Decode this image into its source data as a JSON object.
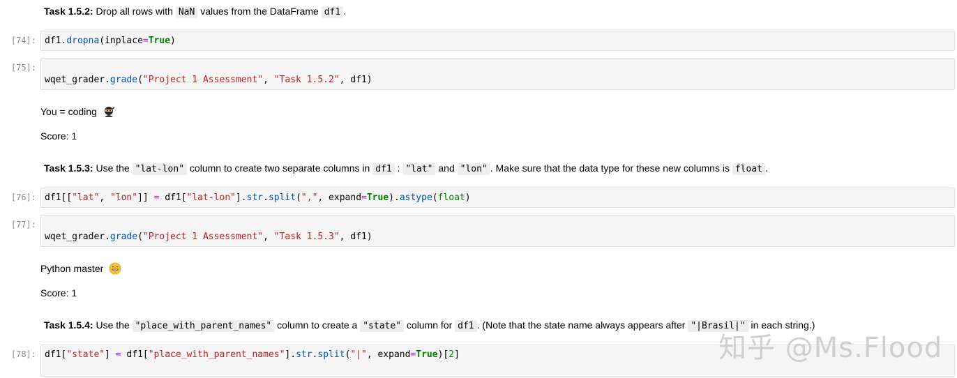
{
  "tasks": {
    "t152": {
      "label": "Task 1.5.2:",
      "text1": " Drop all rows with ",
      "code1": "NaN",
      "text2": " values from the DataFrame ",
      "code2": "df1",
      "text3": "."
    },
    "t153": {
      "label": "Task 1.5.3:",
      "text1": " Use the ",
      "code1": "\"lat-lon\"",
      "text2": " column to create two separate columns in ",
      "code2": "df1",
      "text3": " : ",
      "code3": "\"lat\"",
      "text4": " and ",
      "code4": "\"lon\"",
      "text5": ". Make sure that the data type for these new columns is ",
      "code5": "float",
      "text6": "."
    },
    "t154": {
      "label": "Task 1.5.4:",
      "text1": " Use the ",
      "code1": "\"place_with_parent_names\"",
      "text2": " column to create a ",
      "code2": "\"state\"",
      "text3": " column for ",
      "code3": "df1",
      "text4": ". (Note that the state name always appears after ",
      "code4": "\"|Brasil|\"",
      "text5": " in each string.)"
    }
  },
  "cells": {
    "c74": {
      "prompt": "[74]:",
      "tokens": {
        "a": "df1.",
        "b": "dropna",
        "c": "(inplace",
        "d": "=",
        "e": "True",
        "f": ")"
      }
    },
    "c75": {
      "prompt": "[75]:",
      "tokens": {
        "a": "wqet_grader.",
        "b": "grade",
        "c": "(",
        "d": "\"Project 1 Assessment\"",
        "e": ", ",
        "f": "\"Task 1.5.2\"",
        "g": ", df1)"
      }
    },
    "c76": {
      "prompt": "[76]:",
      "tokens": {
        "a": "df1[[",
        "b": "\"lat\"",
        "c": ", ",
        "d": "\"lon\"",
        "e": "]] ",
        "f": "=",
        "g": " df1[",
        "h": "\"lat-lon\"",
        "i": "].",
        "j": "str",
        "k": ".",
        "l": "split",
        "m": "(",
        "n": "\",\"",
        "o": ", expand",
        "p": "=",
        "q": "True",
        "r": ").",
        "s": "astype",
        "t": "(",
        "u": "float",
        "v": ")"
      }
    },
    "c77": {
      "prompt": "[77]:",
      "tokens": {
        "a": "wqet_grader.",
        "b": "grade",
        "c": "(",
        "d": "\"Project 1 Assessment\"",
        "e": ", ",
        "f": "\"Task 1.5.3\"",
        "g": ", df1)"
      }
    },
    "c78": {
      "prompt": "[78]:",
      "tokens": {
        "a": "df1[",
        "b": "\"state\"",
        "c": "] ",
        "d": "=",
        "e": " df1[",
        "f": "\"place_with_parent_names\"",
        "g": "].",
        "h": "str",
        "i": ".",
        "j": "split",
        "k": "(",
        "l": "\"|\"",
        "m": ", expand",
        "n": "=",
        "o": "True",
        "p": ")[",
        "q": "2",
        "r": "]"
      }
    }
  },
  "outputs": {
    "o75": {
      "message": "You = coding",
      "emoji_icon": "ninja-icon",
      "score": "Score: 1"
    },
    "o77": {
      "message": "Python master",
      "emoji_icon": "grinning-face-icon",
      "score": "Score: 1"
    }
  },
  "watermark": "知乎 @Ms.Flood"
}
